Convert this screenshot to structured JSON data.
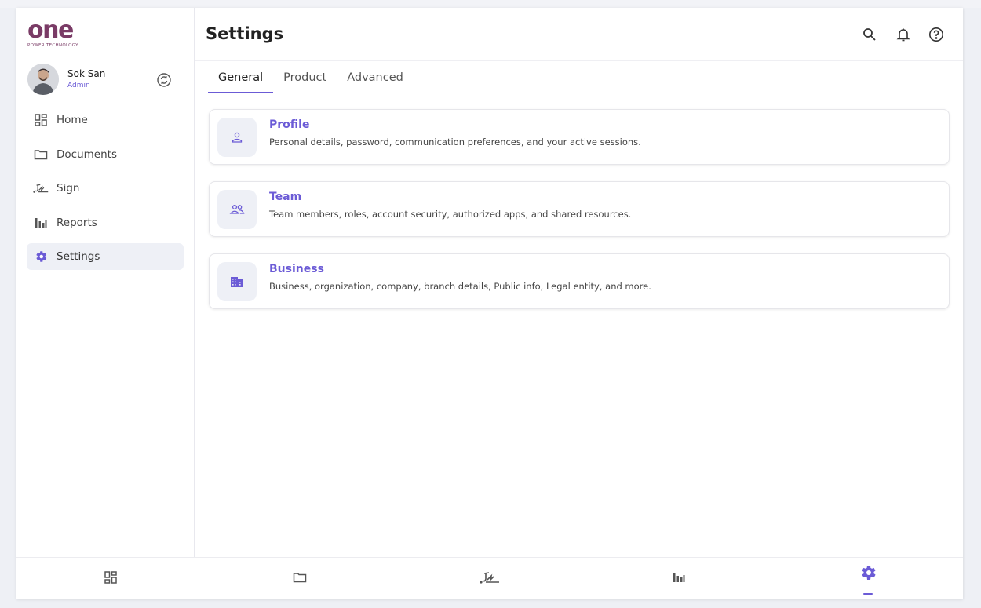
{
  "brand": {
    "logo_text": "one",
    "logo_subtext": "POWER TECHNOLOGY"
  },
  "user": {
    "name": "Sok San",
    "role": "Admin"
  },
  "sidebar": {
    "items": [
      {
        "label": "Home",
        "icon": "dashboard-icon"
      },
      {
        "label": "Documents",
        "icon": "folder-icon"
      },
      {
        "label": "Sign",
        "icon": "signature-icon"
      },
      {
        "label": "Reports",
        "icon": "bar-chart-icon"
      },
      {
        "label": "Settings",
        "icon": "gear-icon",
        "active": true
      }
    ]
  },
  "header": {
    "title": "Settings",
    "icons": [
      "search-icon",
      "bell-icon",
      "help-icon"
    ]
  },
  "tabs": [
    {
      "label": "General",
      "active": true
    },
    {
      "label": "Product"
    },
    {
      "label": "Advanced"
    }
  ],
  "cards": [
    {
      "title": "Profile",
      "description": "Personal details, password, communication preferences, and your active sessions.",
      "icon": "person-icon"
    },
    {
      "title": "Team",
      "description": "Team members, roles, account security, authorized apps, and shared resources.",
      "icon": "people-icon"
    },
    {
      "title": "Business",
      "description": "Business, organization, company, branch details, Public info, Legal entity, and more.",
      "icon": "building-icon"
    }
  ],
  "bottom_nav": [
    "dashboard-icon",
    "folder-icon",
    "signature-icon",
    "bar-chart-icon",
    "gear-icon"
  ],
  "colors": {
    "accent": "#6b5bd6",
    "brand": "#7a3b66",
    "icon": "#555555",
    "active_bg": "#eef0f6"
  }
}
